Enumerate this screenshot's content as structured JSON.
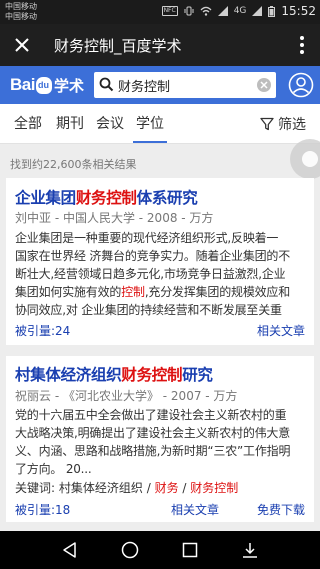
{
  "status_bar": {
    "carrier_1": "中国移动",
    "carrier_2": "中国移动",
    "nfc": "NFC",
    "signal": "4G",
    "time": "15:52"
  },
  "title_bar": {
    "title": "财务控制_百度学术",
    "close_icon": "close-icon",
    "more_icon": "more-vertical-icon"
  },
  "search": {
    "logo_text": "Bai",
    "logo_suffix": "学术",
    "query": "财务控制",
    "search_icon": "search-icon",
    "clear_icon": "clear-icon",
    "user_icon": "user-icon"
  },
  "tabs": [
    {
      "label": "全部"
    },
    {
      "label": "期刊"
    },
    {
      "label": "会议"
    },
    {
      "label": "学位"
    }
  ],
  "active_tab": "学位",
  "filter_label": "筛选",
  "result_count": "找到约22,600条相关结果",
  "results": [
    {
      "title_parts": [
        "企业集团",
        "财务控制",
        "体系研究"
      ],
      "meta": "刘中亚 - 中国人民大学 - 2008 - 万方",
      "abstract_lines": [
        [
          "企业集团是一种重要的现代经济组织形式,反映着一"
        ],
        [
          "国家在世界经 济舞台的竞争实力。随着企业集团的不"
        ],
        [
          "断壮大,经营领域日趋多元化,市场竞争日益激烈,企业"
        ],
        [
          "集团如何实施有效的",
          "控制",
          ",充分发挥集团的规模效应和"
        ],
        [
          "协同效应,对 企业集团的持续经营和不断发展至关重"
        ]
      ],
      "citations": "被引量:24",
      "links": [
        "相关文章"
      ]
    },
    {
      "title_parts": [
        "村集体经济组织",
        "财务控制",
        "研究"
      ],
      "meta": "祝丽云 - 《河北农业大学》 - 2007 - 万方",
      "abstract_lines": [
        [
          "党的十六届五中全会做出了建设社会主义新农村的重"
        ],
        [
          "大战略决策,明确提出了建设社会主义新农村的伟大意"
        ],
        [
          "义、内涵、思路和战略措施,为新时期“三农”工作指明"
        ],
        [
          "了方向。 20..."
        ]
      ],
      "keywords_label": "关键词:",
      "keywords": [
        "村集体经济组织",
        "财务",
        "财务控制"
      ],
      "citations": "被引量:18",
      "links": [
        "相关文章",
        "免费下载"
      ]
    }
  ],
  "nav": {
    "back_icon": "back-icon",
    "home_icon": "home-icon",
    "recents_icon": "recents-icon",
    "extra_icon": "download-icon"
  },
  "colors": {
    "title_bar": "#1f1f1f",
    "search_header": "#3c6fd8",
    "link_blue": "#1a3fb0",
    "highlight_red": "#dd1111"
  }
}
